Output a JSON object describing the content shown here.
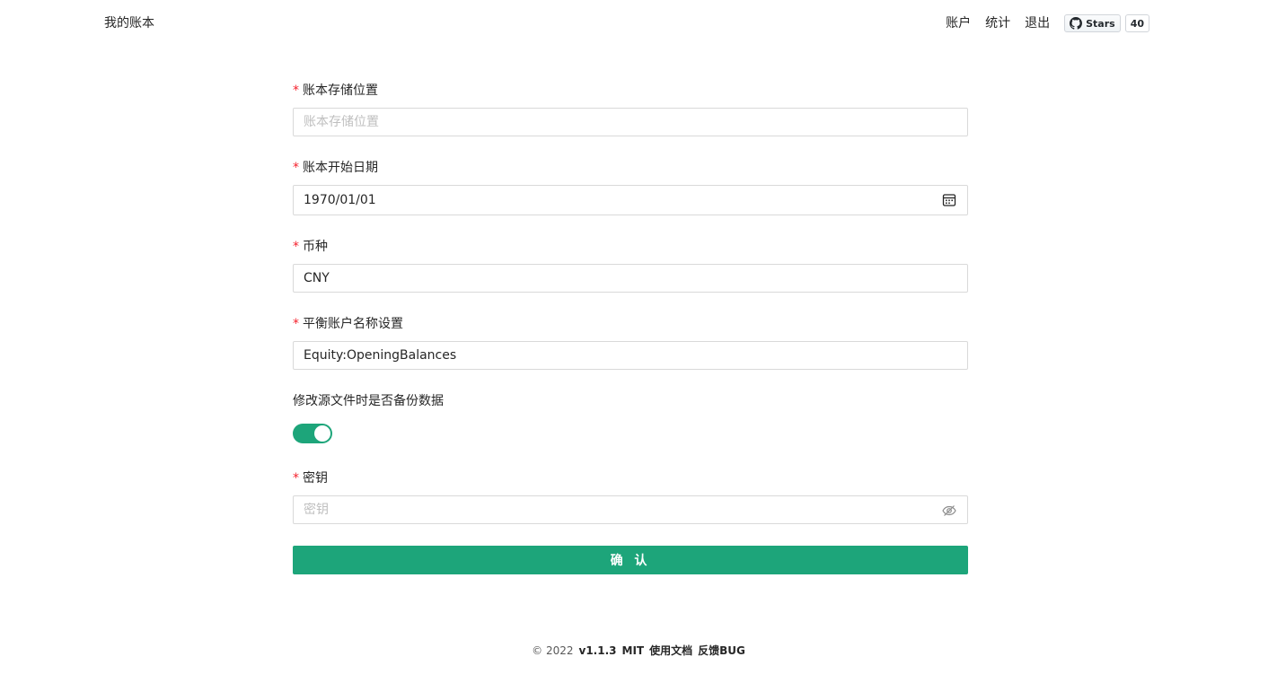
{
  "header": {
    "brand": "我的账本",
    "nav": [
      "账户",
      "统计",
      "退出"
    ],
    "github": {
      "label": "Stars",
      "count": "40"
    }
  },
  "form": {
    "ledger_location": {
      "label": "账本存储位置",
      "value": "",
      "placeholder": "账本存储位置",
      "required": true
    },
    "start_date": {
      "label": "账本开始日期",
      "value": "1970/01/01",
      "required": true
    },
    "currency": {
      "label": "币种",
      "value": "CNY",
      "required": true
    },
    "balance_account": {
      "label": "平衡账户名称设置",
      "value": "Equity:OpeningBalances",
      "required": true
    },
    "backup": {
      "label": "修改源文件时是否备份数据",
      "enabled": true
    },
    "secret": {
      "label": "密钥",
      "value": "",
      "placeholder": "密钥",
      "required": true
    },
    "submit_label": "确 认"
  },
  "footer": {
    "copyright": "© 2022",
    "version": "v1.1.3",
    "license": "MIT",
    "docs": "使用文档",
    "feedback": "反馈BUG"
  },
  "colors": {
    "primary": "#1da57a",
    "required": "#f5222d"
  }
}
